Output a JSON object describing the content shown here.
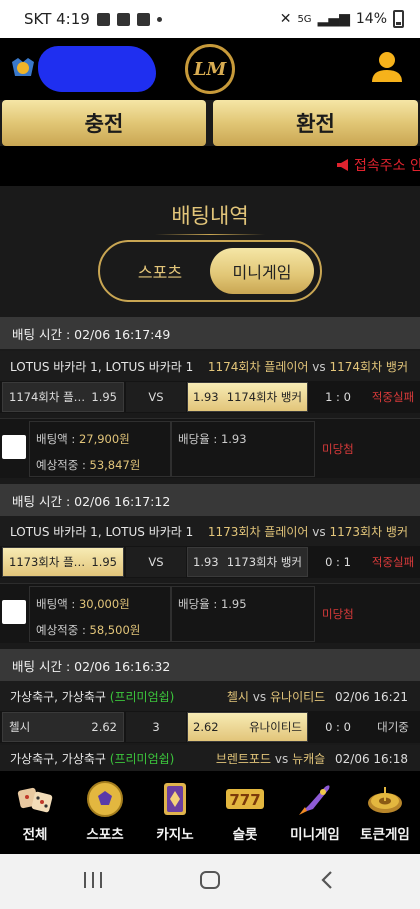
{
  "status_bar": {
    "carrier_time": "SKT 4:19",
    "signal": "5G",
    "battery": "14%"
  },
  "header": {
    "logo_text": "LM"
  },
  "actions": {
    "charge": "충전",
    "exchange": "환전"
  },
  "notice": {
    "text": "접속주소 안"
  },
  "page": {
    "title": "배팅내역"
  },
  "tabs": {
    "sports": "스포츠",
    "minigame": "미니게임",
    "selected": "minigame"
  },
  "bets": [
    {
      "time": "배팅 시간 : 02/06 16:17:49",
      "game": "LOTUS 바카라 1, LOTUS 바카라 1",
      "home_team": "1174회차 플레이어",
      "away_team": "1174회차 뱅커",
      "vs": "vs",
      "home_pick": "1174회차 플레…",
      "home_odd": "1.95",
      "draw": "VS",
      "away_odd": "1.93",
      "away_pick": "1174회차 뱅커",
      "score": "1 : 0",
      "result": "적중실패",
      "amount_label": "배팅액 : ",
      "amount": "27,900원",
      "rate_label": "배당율 : ",
      "rate": "1.93",
      "expected_label": "예상적중 : ",
      "expected": "53,847원",
      "status": "미당첨"
    },
    {
      "time": "배팅 시간 : 02/06 16:17:12",
      "game": "LOTUS 바카라 1, LOTUS 바카라 1",
      "home_team": "1173회차 플레이어",
      "away_team": "1173회차 뱅커",
      "vs": "vs",
      "home_pick": "1173회차 플레…",
      "home_odd": "1.95",
      "draw": "VS",
      "away_odd": "1.93",
      "away_pick": "1173회차 뱅커",
      "score": "0 : 1",
      "result": "적중실패",
      "amount_label": "배팅액 : ",
      "amount": "30,000원",
      "rate_label": "배당율 : ",
      "rate": "1.95",
      "expected_label": "예상적중 : ",
      "expected": "58,500원",
      "status": "미당첨"
    },
    {
      "time": "배팅 시간 : 02/06 16:16:32",
      "game": "가상축구, 가상축구",
      "premium": "(프리미엄쉽)",
      "home_team": "첼시",
      "away_team": "유나이티드",
      "vs": "vs",
      "date": "02/06 16:21",
      "home_pick": "첼시",
      "home_odd": "2.62",
      "draw": "3",
      "away_odd": "2.62",
      "away_pick": "유나이티드",
      "score": "0 : 0",
      "result": "대기중"
    },
    {
      "game": "가상축구, 가상축구",
      "premium": "(프리미엄쉽)",
      "home_team": "브렌트포드",
      "away_team": "뉴캐슬",
      "vs": "vs",
      "date": "02/06 16:18"
    }
  ],
  "bottom_nav": [
    {
      "label": "전체",
      "icon": "dice-icon"
    },
    {
      "label": "스포츠",
      "icon": "soccer-ball-icon"
    },
    {
      "label": "카지노",
      "icon": "cards-icon"
    },
    {
      "label": "슬롯",
      "icon": "slot-777-icon"
    },
    {
      "label": "미니게임",
      "icon": "rocket-icon"
    },
    {
      "label": "토큰게임",
      "icon": "roulette-icon"
    }
  ],
  "colors": {
    "gold": "#e1c675",
    "lost": "#d83a3a",
    "premium": "#3cc43c"
  }
}
